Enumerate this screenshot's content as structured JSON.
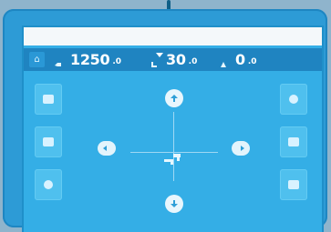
{
  "status": {
    "speed": {
      "value": "1250",
      "unit": ".0"
    },
    "temperature": {
      "value": "30",
      "unit": ".0"
    },
    "third": {
      "value": "0",
      "unit": ".0"
    }
  },
  "icons": {
    "home": "home-icon",
    "speed": "fan-icon",
    "temperature": "thermometer-icon",
    "third": "scale-icon"
  },
  "colors": {
    "screen_bg": "#34aee6",
    "status_bar": "#1f84c1",
    "button": "#4fc0ee",
    "device_body": "#2d9bd6"
  }
}
